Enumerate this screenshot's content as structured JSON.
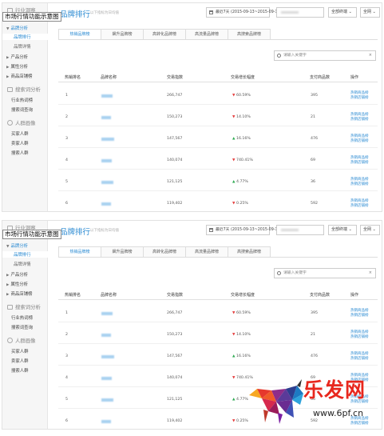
{
  "sidebar": {
    "section_industry": "行业洞察",
    "overlay_label": "市场行情功能示意图",
    "group_brand": "品牌分析",
    "item_brand_rank": "品牌排行",
    "item_brand_detail": "品牌详情",
    "group_product": "产品分析",
    "group_attr": "属性分析",
    "group_store": "商品店铺榜",
    "section_search": "搜索词分析",
    "item_hot_words": "行业热词榜",
    "item_search_query": "搜索词查询",
    "section_crowd": "人群画像",
    "item_buyer": "买家人群",
    "item_seller": "卖家人群",
    "item_searcher": "搜索人群"
  },
  "header": {
    "title": "品牌排行",
    "subtitle": "以下指标为日均值",
    "date_range": "最近7天 (2015-09-13~2015-09-19)",
    "terminal": "全部终端",
    "platform": "全网"
  },
  "tabs": [
    "热销品牌榜",
    "飙升品牌榜",
    "高转化品牌榜",
    "高流量品牌榜",
    "高搜索品牌榜"
  ],
  "search": {
    "placeholder": "请输入关键字",
    "clear": "×"
  },
  "table": {
    "headers": [
      "热销排名",
      "品牌名称",
      "交易指数",
      "交易增长幅度",
      "支付商品数",
      "操作"
    ],
    "rows": [
      {
        "rank": "1",
        "index": "266,747",
        "trend": "down",
        "growth": "60.59%",
        "items": "395",
        "op1": "热销商品榜",
        "op2": "热销店铺榜"
      },
      {
        "rank": "2",
        "index": "150,273",
        "trend": "down",
        "growth": "14.10%",
        "items": "21",
        "op1": "热销商品榜",
        "op2": "热销店铺榜"
      },
      {
        "rank": "3",
        "index": "147,567",
        "trend": "up",
        "growth": "16.16%",
        "items": "476",
        "op1": "热销商品榜",
        "op2": "热销店铺榜"
      },
      {
        "rank": "4",
        "index": "140,074",
        "trend": "down",
        "growth": "740.41%",
        "items": "69",
        "op1": "热销商品榜",
        "op2": "热销店铺榜"
      },
      {
        "rank": "5",
        "index": "121,125",
        "trend": "up",
        "growth": "4.77%",
        "items": "36",
        "op1": "热销商品榜",
        "op2": "热销店铺榜"
      },
      {
        "rank": "6",
        "index": "119,402",
        "trend": "down",
        "growth": "0.25%",
        "items": "592",
        "op1": "热销商品榜",
        "op2": "热销店铺榜"
      }
    ]
  },
  "watermark": {
    "brand": "乐发网",
    "url": "www.6pf.cn"
  },
  "colors": {
    "accent": "#2a8ad2",
    "up": "#2caa50",
    "down": "#e43d3d",
    "watermark": "#e8271d"
  }
}
